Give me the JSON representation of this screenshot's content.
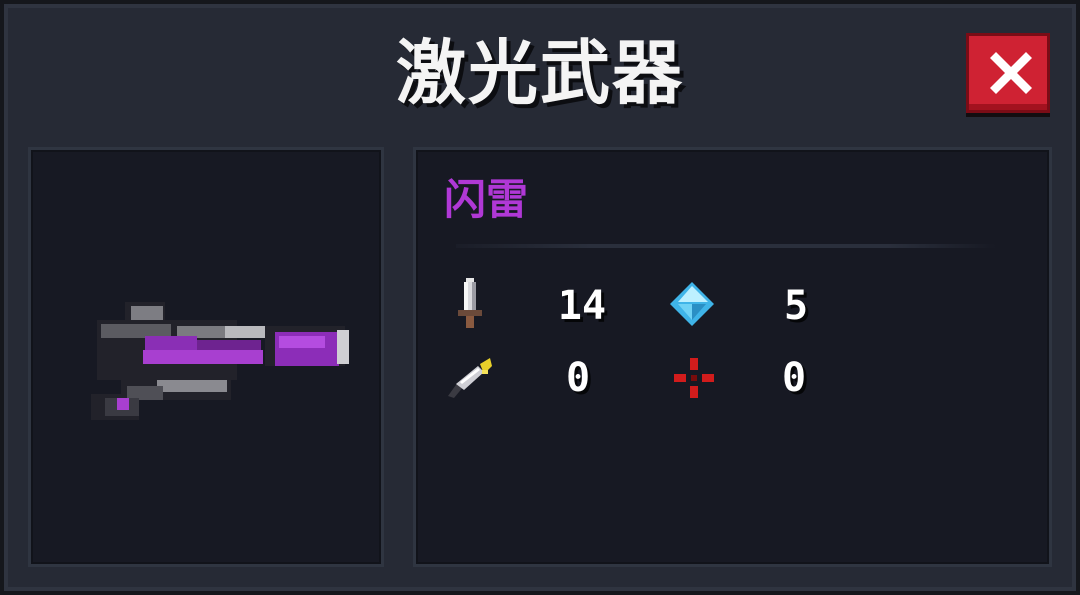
{
  "dialog": {
    "title": "激光武器"
  },
  "weapon": {
    "name": "闪雷",
    "name_color": "#b038d6",
    "icon": "laser-gun-icon"
  },
  "stats": {
    "damage": {
      "icon": "sword-icon",
      "value": "14"
    },
    "energy_cost": {
      "icon": "blue-crystal-icon",
      "value": "5"
    },
    "crit_chance": {
      "icon": "feather-dagger-icon",
      "value": "0"
    },
    "accuracy_spread": {
      "icon": "red-crosshair-icon",
      "value": "0"
    }
  },
  "colors": {
    "close_button": "#cf2233",
    "panel_background": "#171923",
    "frame_background": "#262a35"
  }
}
